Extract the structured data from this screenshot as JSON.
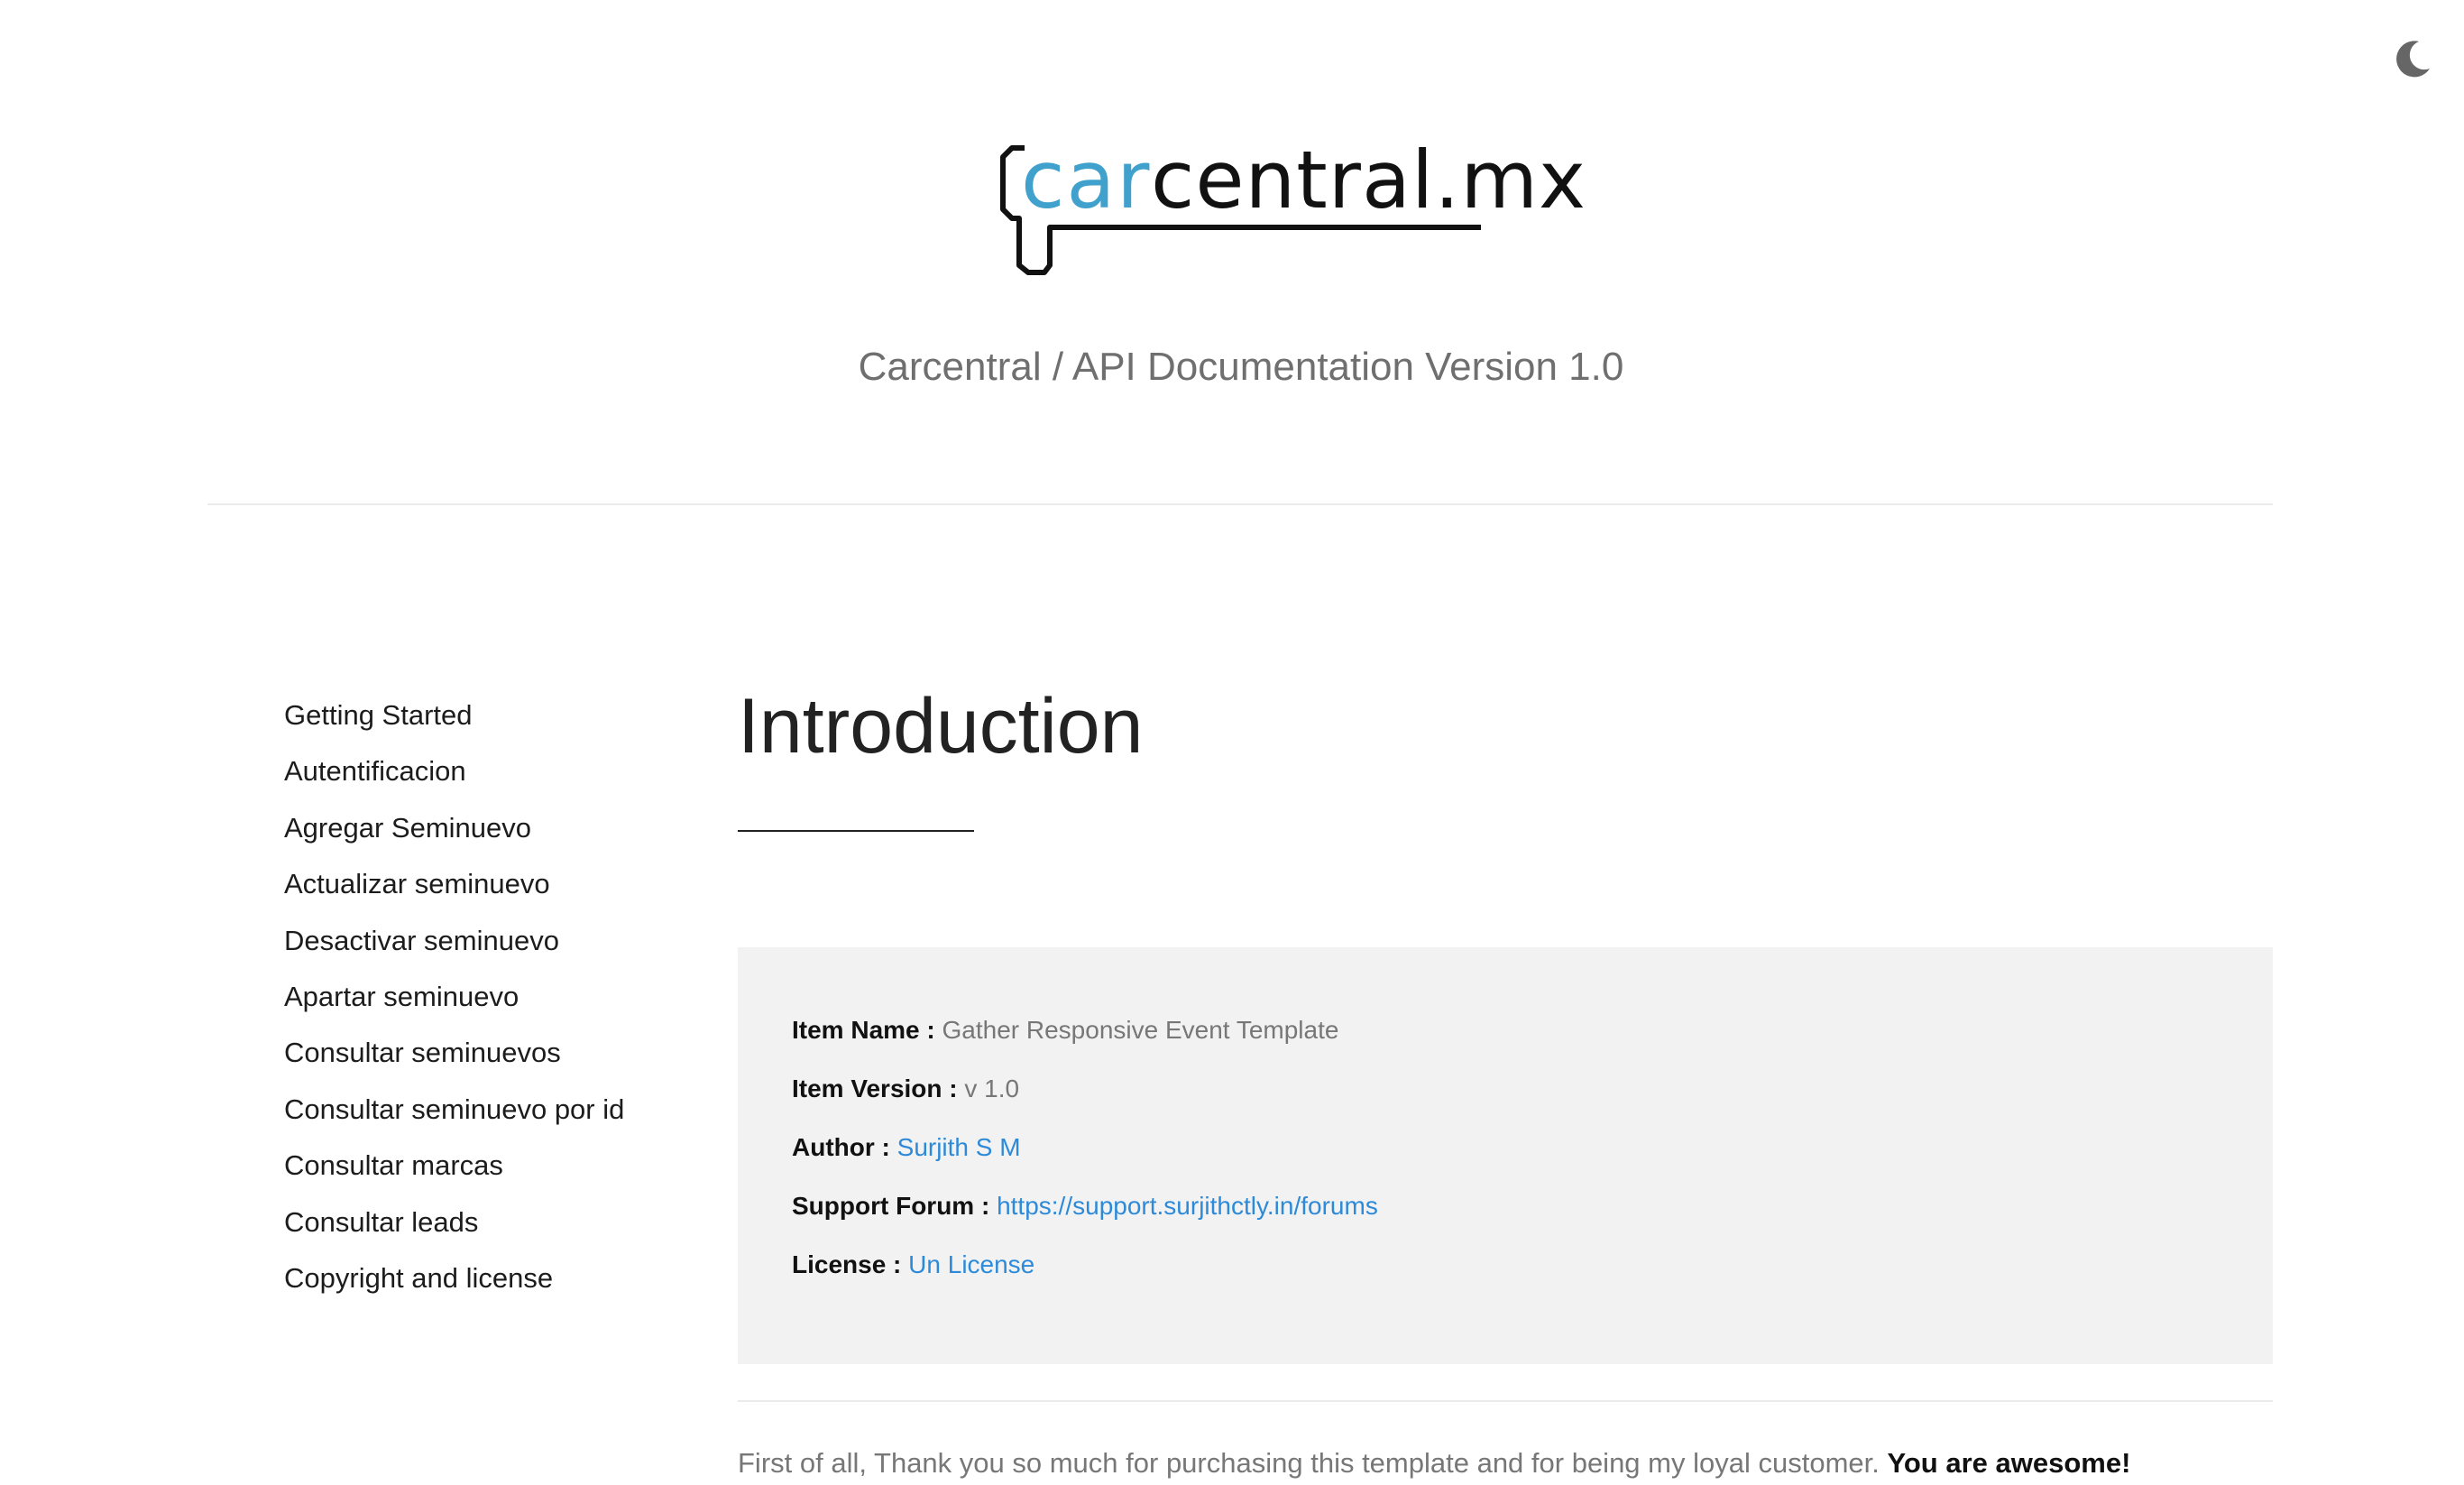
{
  "header": {
    "logo_text_part1": "car",
    "logo_text_part2": "central.mx",
    "subtitle": "Carcentral / API Documentation Version 1.0"
  },
  "theme_toggle": {
    "icon": "moon-icon"
  },
  "sidebar": {
    "items": [
      {
        "label": "Getting Started"
      },
      {
        "label": "Autentificacion"
      },
      {
        "label": "Agregar Seminuevo"
      },
      {
        "label": "Actualizar seminuevo"
      },
      {
        "label": "Desactivar seminuevo"
      },
      {
        "label": "Apartar seminuevo"
      },
      {
        "label": "Consultar seminuevos"
      },
      {
        "label": "Consultar seminuevo por id"
      },
      {
        "label": "Consultar marcas"
      },
      {
        "label": "Consultar leads"
      },
      {
        "label": "Copyright and license"
      }
    ]
  },
  "main": {
    "title": "Introduction",
    "info": {
      "item_name_label": "Item Name :",
      "item_name_value": "Gather Responsive Event Template",
      "item_version_label": "Item Version :",
      "item_version_value": "v 1.0",
      "author_label": "Author :",
      "author_value": "Surjith S M",
      "support_label": "Support Forum :",
      "support_value": "https://support.surjithctly.in/forums",
      "license_label": "License :",
      "license_value": "Un License"
    },
    "intro_paragraph": "First of all, Thank you so much for purchasing this template and for being my loyal customer.",
    "intro_paragraph_bold": "You are awesome!"
  },
  "colors": {
    "accent_link": "#2d8ad8",
    "logo_blue": "#3fa1cc",
    "info_box_bg": "#f2f2f2"
  }
}
